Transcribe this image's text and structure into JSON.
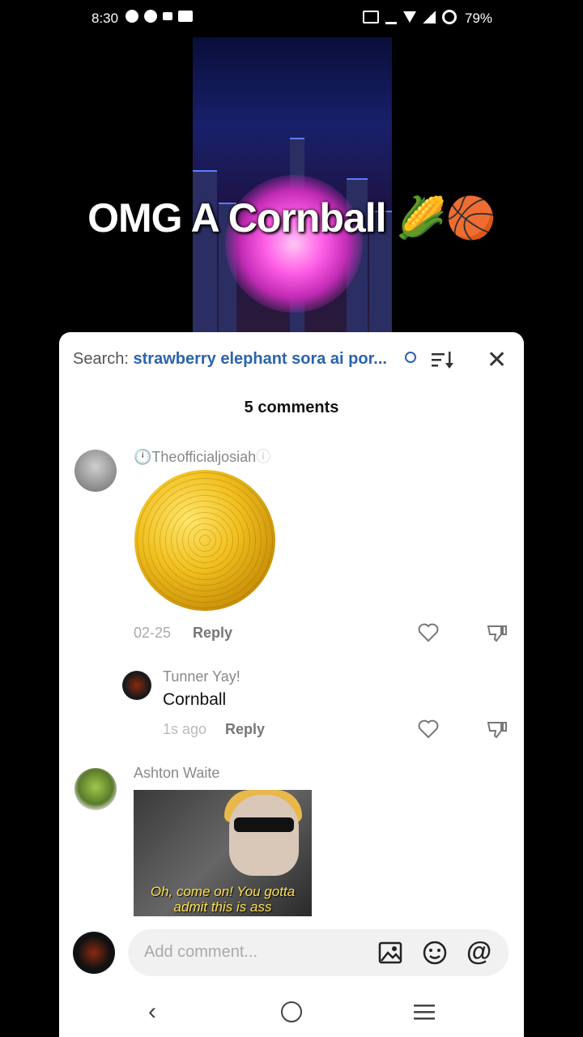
{
  "status_bar": {
    "time": "8:30",
    "battery": "79%"
  },
  "video": {
    "overlay_title": "OMG A Cornball 🌽🏀"
  },
  "comments_sheet": {
    "search_label": "Search:",
    "search_query": "strawberry elephant sora ai por...",
    "comment_count": "5 comments",
    "comments": [
      {
        "username": "Theofficialjosiah",
        "date": "02-25",
        "reply_label": "Reply"
      },
      {
        "username": "Tunner Yay!",
        "text": "Cornball",
        "date": "1s ago",
        "reply_label": "Reply"
      },
      {
        "username": "Ashton Waite",
        "image_caption": "Oh, come on! You gotta admit this is ass"
      }
    ],
    "add_comment_placeholder": "Add comment..."
  },
  "icons": [
    "search-icon",
    "sort-icon",
    "close-icon",
    "heart-icon",
    "dislike-icon",
    "image-icon",
    "emoji-icon",
    "mention-icon",
    "back-icon",
    "home-icon",
    "menu-icon"
  ]
}
